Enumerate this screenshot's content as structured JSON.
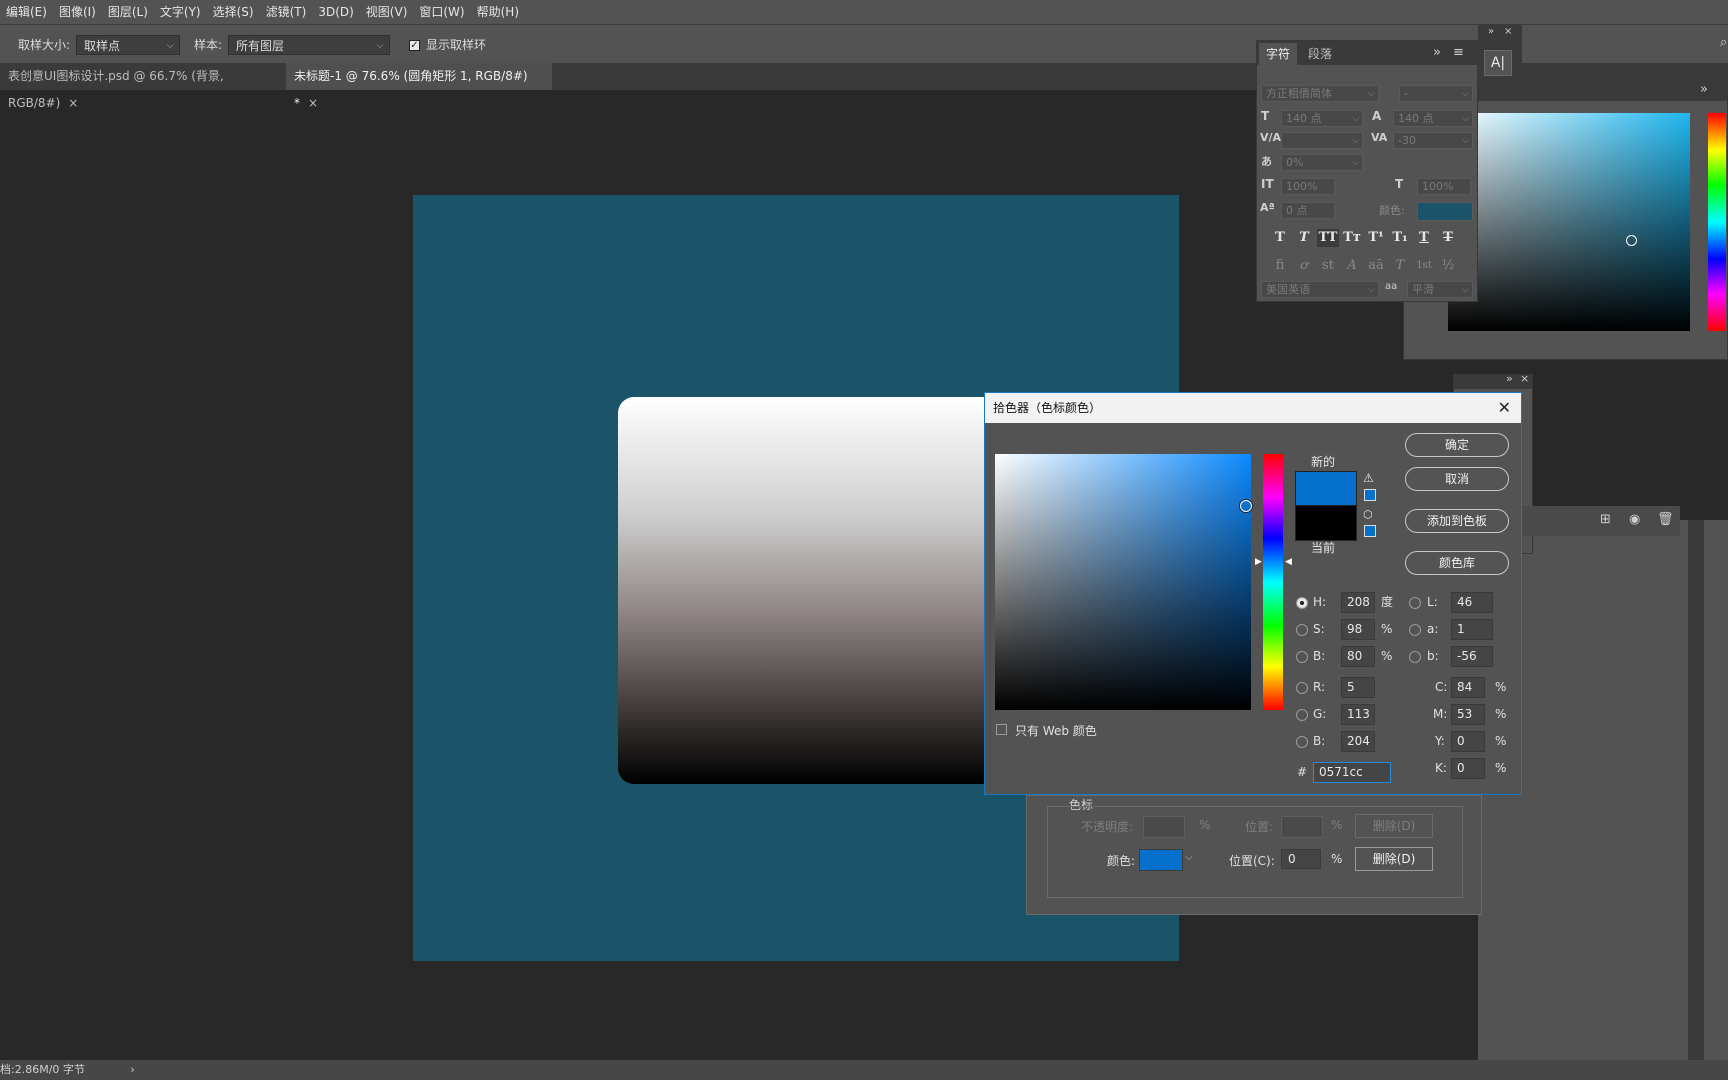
{
  "menu": [
    "编辑(E)",
    "图像(I)",
    "图层(L)",
    "文字(Y)",
    "选择(S)",
    "滤镜(T)",
    "3D(D)",
    "视图(V)",
    "窗口(W)",
    "帮助(H)"
  ],
  "options": {
    "sample_size_label": "取样大小:",
    "sample_size_value": "取样点",
    "sample_label": "样本:",
    "sample_value": "所有图层",
    "show_ring_label": "显示取样环"
  },
  "tabs": [
    {
      "label": "表创意UI图标设计.psd @ 66.7% (背景, RGB/8#)",
      "close": "×"
    },
    {
      "label": "未标题-1 @ 76.6% (圆角矩形 1, RGB/8#) *",
      "close": "×"
    }
  ],
  "char_panel": {
    "tab_char": "字符",
    "tab_para": "段落",
    "font_family": "方正粗倩简体",
    "font_style": "-",
    "size": "140 点",
    "leading": "140 点",
    "kerning": "",
    "tracking": "-30",
    "tsume": "0%",
    "vscale": "100%",
    "hscale": "100%",
    "baseline": "0 点",
    "color_label": "颜色:",
    "color_value": "#1b5369",
    "language": "美国英语",
    "aa_icon": "aa",
    "antialias": "平滑",
    "style_buttons": [
      "T",
      "T",
      "TT",
      "Tт",
      "T¹",
      "T₁",
      "T",
      "T"
    ],
    "ot_buttons": [
      "fi",
      "ơ",
      "st",
      "A",
      "aā",
      "T",
      "1st",
      "½"
    ]
  },
  "color_panel": {
    "current_color": "#1fb6ef"
  },
  "picker": {
    "title": "拾色器（色标颜色）",
    "ok": "确定",
    "cancel": "取消",
    "add_swatch": "添加到色板",
    "library": "颜色库",
    "new_label": "新的",
    "current_label": "当前",
    "new_color": "#0571cc",
    "current_color": "#000000",
    "web_only": "只有 Web 颜色",
    "hue_base": "#0c8aff",
    "hsb": {
      "H": "208",
      "H_unit": "度",
      "S": "98",
      "S_unit": "%",
      "B": "80",
      "B_unit": "%"
    },
    "rgb": {
      "R": "5",
      "G": "113",
      "B": "204"
    },
    "lab": {
      "L": "46",
      "a": "1",
      "b": "-56"
    },
    "cmyk": {
      "C": "84",
      "M": "53",
      "Y": "0",
      "K": "0",
      "unit": "%"
    },
    "hex_label": "#",
    "hex": "0571cc"
  },
  "gradient_editor": {
    "section_label": "色标",
    "opacity_label": "不透明度:",
    "opacity_unit": "%",
    "location_label_dim": "位置:",
    "location_unit_dim": "%",
    "delete_dim": "删除(D)",
    "color_label": "颜色:",
    "color_value": "#0571cc",
    "location_label": "位置(C):",
    "location_value": "0",
    "location_unit": "%",
    "delete": "删除(D)"
  },
  "status": "档:2.86M/0 字节"
}
